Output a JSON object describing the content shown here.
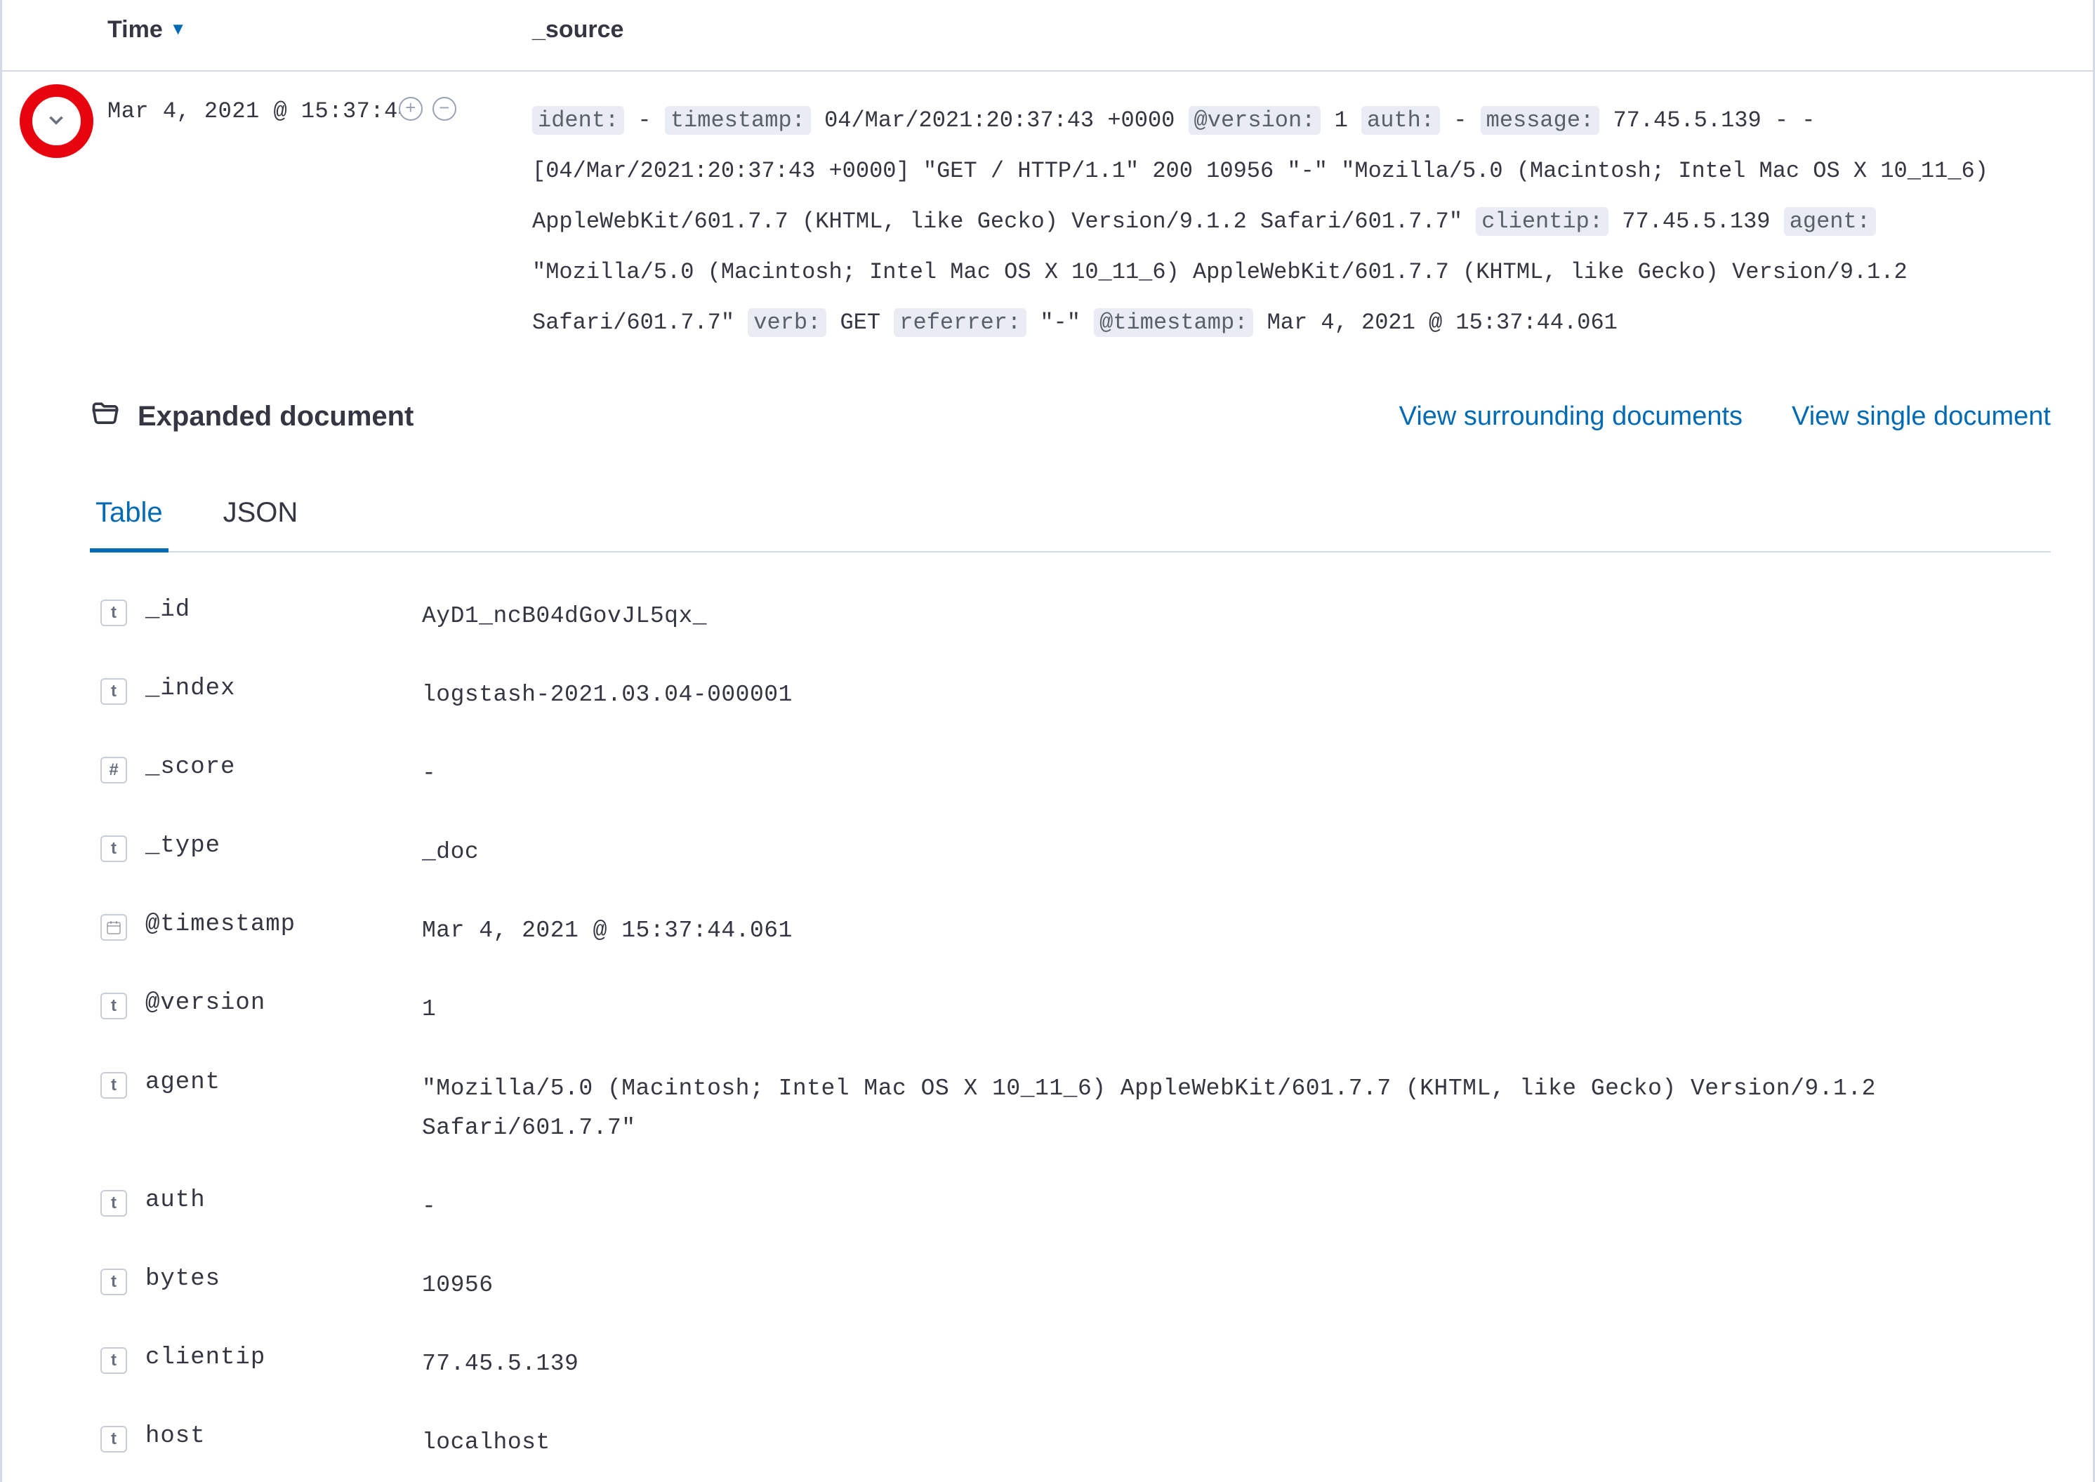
{
  "columns": {
    "time": "Time",
    "source": "_source"
  },
  "row": {
    "time": "Mar 4, 2021 @ 15:37:44",
    "source_pairs": [
      {
        "k": "ident:",
        "v": " - "
      },
      {
        "k": "timestamp:",
        "v": " 04/Mar/2021:20:37:43 +0000 "
      },
      {
        "k": "@version:",
        "v": " 1 "
      },
      {
        "k": "auth:",
        "v": " - "
      },
      {
        "k": "message:",
        "v": " 77.45.5.139 - - [04/Mar/2021:20:37:43 +0000] \"GET / HTTP/1.1\" 200 10956 \"-\" \"Mozilla/5.0 (Macintosh; Intel Mac OS X 10_11_6) AppleWebKit/601.7.7 (KHTML, like Gecko) Version/9.1.2 Safari/601.7.7\" "
      },
      {
        "k": "clientip:",
        "v": " 77.45.5.139 "
      },
      {
        "k": "agent:",
        "v": " \"Mozilla/5.0 (Macintosh; Intel Mac OS X 10_11_6) AppleWebKit/601.7.7 (KHTML, like Gecko) Version/9.1.2 Safari/601.7.7\" "
      },
      {
        "k": "verb:",
        "v": " GET "
      },
      {
        "k": "referrer:",
        "v": " \"-\" "
      },
      {
        "k": "@timestamp:",
        "v": " Mar 4, 2021 @ 15:37:44.061"
      }
    ]
  },
  "expanded": {
    "title": "Expanded document",
    "links": {
      "surrounding": "View surrounding documents",
      "single": "View single document"
    },
    "tabs": {
      "table": "Table",
      "json": "JSON"
    },
    "fields": [
      {
        "type": "t",
        "name": "_id",
        "value": "AyD1_ncB04dGovJL5qx_"
      },
      {
        "type": "t",
        "name": "_index",
        "value": "logstash-2021.03.04-000001"
      },
      {
        "type": "#",
        "name": "_score",
        "value": "-"
      },
      {
        "type": "t",
        "name": "_type",
        "value": "_doc"
      },
      {
        "type": "date",
        "name": "@timestamp",
        "value": "Mar 4, 2021 @ 15:37:44.061"
      },
      {
        "type": "t",
        "name": "@version",
        "value": "1"
      },
      {
        "type": "t",
        "name": "agent",
        "value": "\"Mozilla/5.0 (Macintosh; Intel Mac OS X 10_11_6) AppleWebKit/601.7.7 (KHTML, like Gecko) Version/9.1.2 Safari/601.7.7\""
      },
      {
        "type": "t",
        "name": "auth",
        "value": "-"
      },
      {
        "type": "t",
        "name": "bytes",
        "value": "10956"
      },
      {
        "type": "t",
        "name": "clientip",
        "value": "77.45.5.139"
      },
      {
        "type": "t",
        "name": "host",
        "value": "localhost"
      }
    ]
  }
}
